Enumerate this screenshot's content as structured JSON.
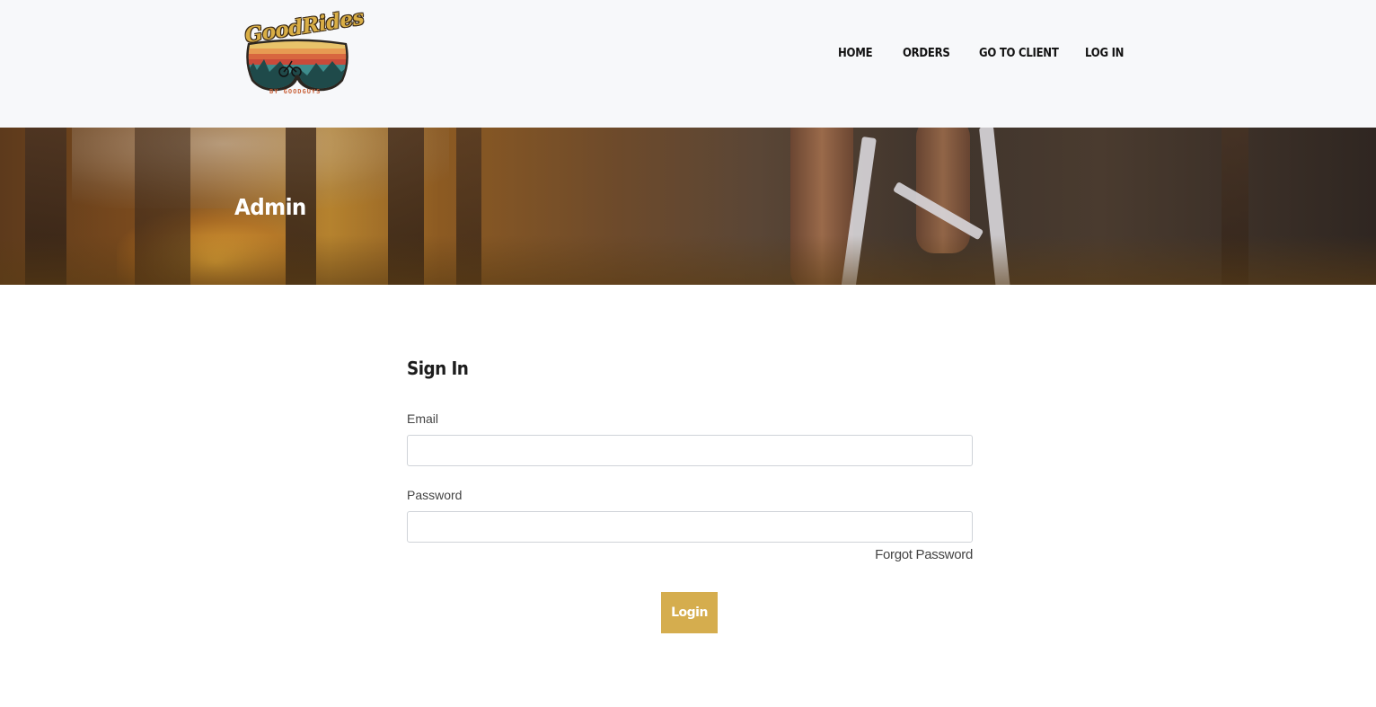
{
  "header": {
    "logo": {
      "script_text": "GoodRides",
      "sub_text": "BY GOODGUYS",
      "colors": {
        "gold": "#d9ae45",
        "outline": "#3a2a17",
        "orange": "#c9623a"
      }
    },
    "nav": [
      {
        "label": "HOME"
      },
      {
        "label": "ORDERS"
      },
      {
        "label": "GO TO CLIENT"
      },
      {
        "label": "LOG IN"
      }
    ]
  },
  "hero": {
    "title": "Admin"
  },
  "form": {
    "title": "Sign In",
    "email": {
      "label": "Email",
      "value": "",
      "placeholder": ""
    },
    "password": {
      "label": "Password",
      "value": "",
      "placeholder": ""
    },
    "forgot_label": "Forgot Password",
    "login_label": "Login"
  },
  "colors": {
    "accent": "#d5ad4e",
    "header_bg": "#f7f8fa",
    "input_border": "#cfd3d8"
  }
}
